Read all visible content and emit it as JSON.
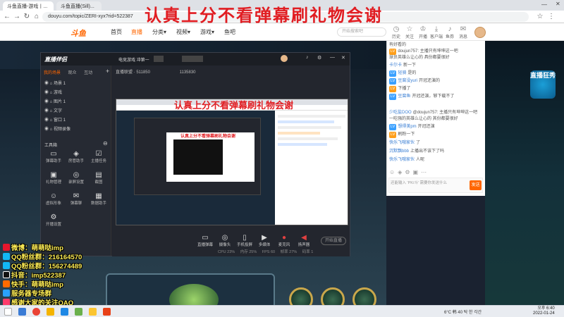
{
  "overlay_title": "认真上分不看弹幕刷礼物会谢",
  "browser": {
    "tabs": [
      "斗鱼直播-游戏丨...",
      "斗鱼直播(Sill)..."
    ],
    "url": "douyu.com/topic/ZERI-xyx?rid=522387"
  },
  "site": {
    "logo": "斗鱼",
    "nav": [
      "首页",
      "直播",
      "分类▾",
      "视频▾",
      "游戏▾",
      "鱼吧"
    ],
    "active_nav": "直播",
    "search_placeholder": "开始搜索吧",
    "header_icons": [
      {
        "icon": "gift-icon",
        "label": "历史"
      },
      {
        "icon": "star-icon",
        "label": "关注"
      },
      {
        "icon": "crown-icon",
        "label": "开播"
      },
      {
        "icon": "download-icon",
        "label": "客户端"
      },
      {
        "icon": "bell-icon",
        "label": "鱼券"
      },
      {
        "icon": "message-icon",
        "label": "消息"
      },
      {
        "icon": "play-icon",
        "label": "创作中心"
      }
    ]
  },
  "obs": {
    "title": "直播伴侣",
    "sidebar_tabs": [
      "我的场景",
      "观众",
      "互动"
    ],
    "scenes": [
      "场景 1",
      "游戏",
      "图片 1",
      "文字",
      "窗口 1",
      "视频录像"
    ],
    "tools_title": "工具箱",
    "tools": [
      "弹幕助手",
      "房管助手",
      "主播任务",
      "礼物管理",
      "录屏设置",
      "截图",
      "虚拟形象",
      "弹幕聊",
      "数据助手",
      "开播设置"
    ],
    "room_title": "电竞游戏 冲第一",
    "stream_label": "直播联盟 · 511850",
    "viewer_label": "1135830",
    "preview_overlay": "认真上分不看弹幕刷礼物会谢",
    "bottom_tools": [
      "直播弹幕",
      "摄像头",
      "手机投屏",
      "多媒体",
      "麦克风",
      "扬声器"
    ],
    "start_button": "开始直播",
    "status_bar": [
      "CPU 23%",
      "内存 25%",
      "FPS 60",
      "帧率 27%",
      "码率 1"
    ]
  },
  "overlay_left": [
    {
      "icon": "weibo-icon",
      "color": "#e6162d",
      "text": "微博：萌萌哒imp"
    },
    {
      "icon": "qq-icon",
      "color": "#12b7f5",
      "text": "QQ粉丝群：216164570"
    },
    {
      "icon": "qq-icon",
      "color": "#12b7f5",
      "text": "QQ粉丝群：156274489"
    },
    {
      "icon": "tiktok-icon",
      "color": "#111111",
      "text": "抖音：imp522387"
    },
    {
      "icon": "kuaishou-icon",
      "color": "#ff6a00",
      "text": "快手：萌萌哒imp"
    },
    {
      "icon": "game-icon",
      "color": "#2aa1ff",
      "text": "服务器专场群"
    },
    {
      "icon": "heart-icon",
      "color": "#ff3b6b",
      "text": "感谢大家的关注QAQ"
    }
  ],
  "chat": [
    {
      "badge": "",
      "badge_color": "#ffb300",
      "user": "",
      "text": "有好看的"
    },
    {
      "badge": "",
      "badge_color": "#aaa",
      "user": "",
      "text": "doujun757: 主播只有坤坤这一吧"
    },
    {
      "badge": "",
      "badge_color": "#aaa",
      "user": "",
      "text": "球员英雄么让心的 具份都要很好"
    },
    {
      "badge": "",
      "badge_color": "#8bc34a",
      "user": "卡尔卡",
      "text": "新一下"
    },
    {
      "badge": "LV",
      "badge_color": "#3aa0ff",
      "user": "轻骑",
      "text": "是的"
    },
    {
      "badge": "LV",
      "badge_color": "#3aa0ff",
      "user": "豆腐没yuri",
      "text": "开冠还演的"
    },
    {
      "badge": "LV",
      "badge_color": "#ff9f1a",
      "user": "",
      "text": "下播了"
    },
    {
      "badge": "LV",
      "badge_color": "#3aa0ff",
      "user": "豆腐鱼",
      "text": "开冠还演，够下载不了"
    },
    {
      "badge": "",
      "badge_color": "#aaa",
      "user": "少吃盐DOO",
      "text": "@doujun757: 主播只有坤坤这一吧"
    },
    {
      "badge": "",
      "badge_color": "#aaa",
      "user": "",
      "text": "一吃强的英雄么让心的 其份都要很好"
    },
    {
      "badge": "LV",
      "badge_color": "#3aa0ff",
      "user": "想得美pm",
      "text": "开冠还演"
    },
    {
      "badge": "LV",
      "badge_color": "#ff9f1a",
      "user": "",
      "text": "刷粉一下"
    },
    {
      "badge": "",
      "badge_color": "#aaa",
      "user": "快乐飞哦家伙",
      "text": "了"
    },
    {
      "badge": "",
      "badge_color": "#aaa",
      "user": "沉默飘bbb",
      "text": "上播出不该下了吗"
    },
    {
      "badge": "",
      "badge_color": "#aaa",
      "user": "快乐飞哦家伙",
      "text": "人呢"
    }
  ],
  "chat_input_placeholder": "还能输入 'PK/斗' 需要你发送什么",
  "chat_send": "发送",
  "promo_text": "直播狂秀",
  "taskbar": {
    "tray": "6°C  韩  40  탁  한  각간",
    "time": "오후 6:40",
    "date": "2022-01-24"
  }
}
